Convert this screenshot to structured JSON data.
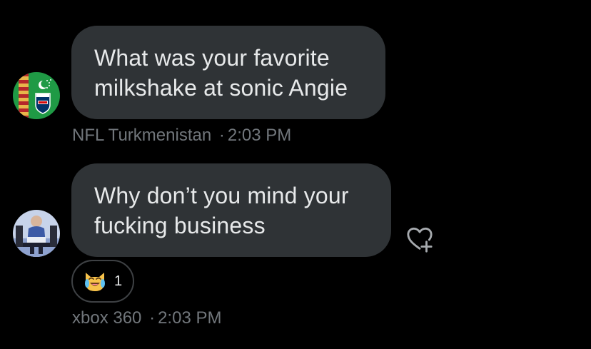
{
  "messages": [
    {
      "text": "What was your favorite milkshake at sonic Angie",
      "sender": "NFL Turkmenistan",
      "time": "2:03 PM",
      "avatar_icon": "nfl-turkmenistan-flag-avatar"
    },
    {
      "text": "Why don’t you mind your fucking business",
      "sender": "xbox 360",
      "time": "2:03 PM",
      "avatar_icon": "person-photo-avatar",
      "reaction": {
        "emoji_icon": "crying-laughing-cat-emoji",
        "count": "1"
      }
    }
  ],
  "meta_separator": "·",
  "colors": {
    "background": "#000000",
    "bubble": "#2f3336",
    "text": "#e7e9ea",
    "meta": "#71767b",
    "flag_green": "#1f9a45"
  }
}
